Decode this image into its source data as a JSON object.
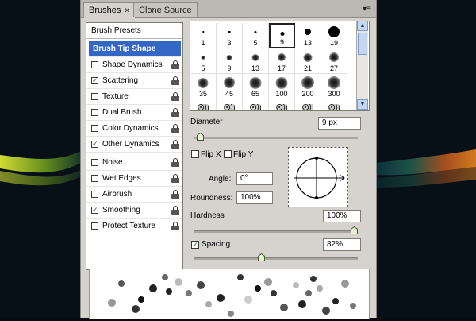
{
  "tabs": [
    {
      "label": "Brushes",
      "active": true
    },
    {
      "label": "Clone Source",
      "active": false
    }
  ],
  "icons": {
    "close": "close-x-icon",
    "panel_menu": "panel-menu-icon",
    "lock": "lock-icon"
  },
  "left_panel": {
    "preset_label": "Brush Presets",
    "header_label": "Brush Tip Shape",
    "items": [
      {
        "label": "Shape Dynamics",
        "checked": false
      },
      {
        "label": "Scattering",
        "checked": true
      },
      {
        "label": "Texture",
        "checked": false
      },
      {
        "label": "Dual Brush",
        "checked": false
      },
      {
        "label": "Color Dynamics",
        "checked": false
      },
      {
        "label": "Other Dynamics",
        "checked": true
      },
      {
        "label": "Noise",
        "checked": false
      },
      {
        "label": "Wet Edges",
        "checked": false
      },
      {
        "label": "Airbrush",
        "checked": false
      },
      {
        "label": "Smoothing",
        "checked": true
      },
      {
        "label": "Protect Texture",
        "checked": false
      }
    ]
  },
  "brush_presets": [
    {
      "size": "1",
      "style": "hard"
    },
    {
      "size": "3",
      "style": "hard"
    },
    {
      "size": "5",
      "style": "hard"
    },
    {
      "size": "9",
      "style": "hard",
      "selected": true
    },
    {
      "size": "13",
      "style": "hard"
    },
    {
      "size": "19",
      "style": "hard"
    },
    {
      "size": "5",
      "style": "soft"
    },
    {
      "size": "9",
      "style": "soft"
    },
    {
      "size": "13",
      "style": "soft"
    },
    {
      "size": "17",
      "style": "soft"
    },
    {
      "size": "21",
      "style": "soft"
    },
    {
      "size": "27",
      "style": "soft"
    },
    {
      "size": "35",
      "style": "soft"
    },
    {
      "size": "45",
      "style": "soft"
    },
    {
      "size": "65",
      "style": "soft"
    },
    {
      "size": "100",
      "style": "soft"
    },
    {
      "size": "200",
      "style": "soft"
    },
    {
      "size": "300",
      "style": "soft"
    },
    {
      "size": "",
      "style": "spatter"
    },
    {
      "size": "",
      "style": "spatter"
    },
    {
      "size": "",
      "style": "spatter"
    },
    {
      "size": "",
      "style": "spatter"
    },
    {
      "size": "",
      "style": "spatter"
    },
    {
      "size": "",
      "style": "spatter"
    }
  ],
  "diameter": {
    "label": "Diameter",
    "value": "9 px",
    "level": 0.02
  },
  "flip_x": {
    "label": "Flip X",
    "checked": false
  },
  "flip_y": {
    "label": "Flip Y",
    "checked": false
  },
  "angle": {
    "label": "Angle:",
    "value": "0°"
  },
  "roundness": {
    "label": "Roundness:",
    "value": "100%"
  },
  "hardness": {
    "label": "Hardness",
    "value": "100%",
    "level": 1.0
  },
  "spacing": {
    "label": "Spacing",
    "value": "82%",
    "checked": true,
    "level": 0.41
  },
  "colors": {
    "panel": "#d6d3ce",
    "highlight": "#3467c5",
    "check": "#2a5c2a"
  }
}
